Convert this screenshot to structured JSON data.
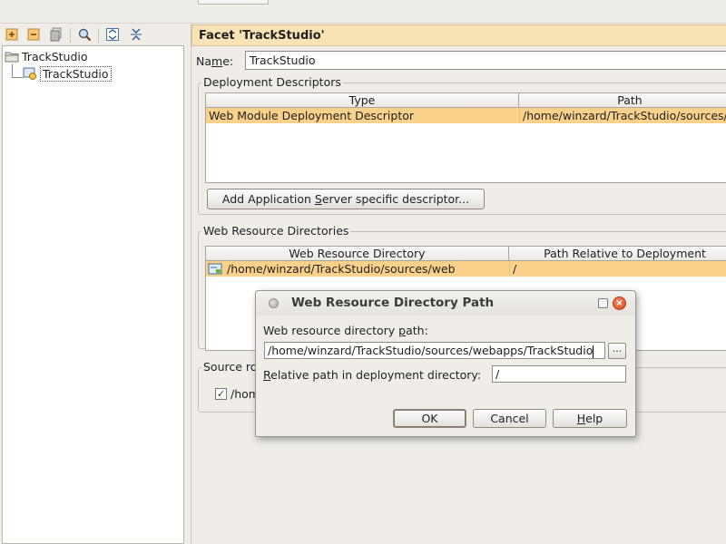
{
  "tree": {
    "root_label": "TrackStudio",
    "child_label": "TrackStudio"
  },
  "toolbar": {
    "icons": [
      "expand-plus-icon",
      "collapse-minus-icon",
      "copy-icon",
      "search-icon",
      "expand-all-icon",
      "collapse-all-icon"
    ]
  },
  "facet": {
    "title": "Facet 'TrackStudio'",
    "name_label_pre": "Na",
    "name_label_mnemonic": "m",
    "name_label_post": "e:",
    "name_value": "TrackStudio"
  },
  "deployment_descriptors": {
    "group_title": "Deployment Descriptors",
    "columns": [
      "Type",
      "Path"
    ],
    "rows": [
      {
        "type": "Web Module Deployment Descriptor",
        "path": "/home/winzard/TrackStudio/sources/"
      }
    ],
    "add_button_pre": "Add Application ",
    "add_button_mnemonic": "S",
    "add_button_post": "erver specific descriptor..."
  },
  "web_resource_dirs": {
    "group_title": "Web Resource Directories",
    "columns": [
      "Web Resource Directory",
      "Path Relative to Deployment"
    ],
    "rows": [
      {
        "directory": "/home/winzard/TrackStudio/sources/web",
        "relative": "/"
      }
    ]
  },
  "source_roots": {
    "group_title": "Source ro",
    "item": "/hom"
  },
  "dialog": {
    "title": "Web Resource Directory Path",
    "path_label_pre": "Web resource directory ",
    "path_label_mnemonic": "p",
    "path_label_post": "ath:",
    "path_value": "/home/winzard/TrackStudio/sources/webapps/TrackStudio",
    "browse_label": "...",
    "relative_label_mnemonic": "R",
    "relative_label_post": "elative path in deployment directory:",
    "relative_value": "/",
    "ok_label": "OK",
    "cancel_label": "Cancel",
    "help_label_mnemonic": "H",
    "help_label_post": "elp"
  },
  "colors": {
    "selection": "#f9d18b",
    "header": "#f8e3b6",
    "close_button": "#e0572a"
  }
}
